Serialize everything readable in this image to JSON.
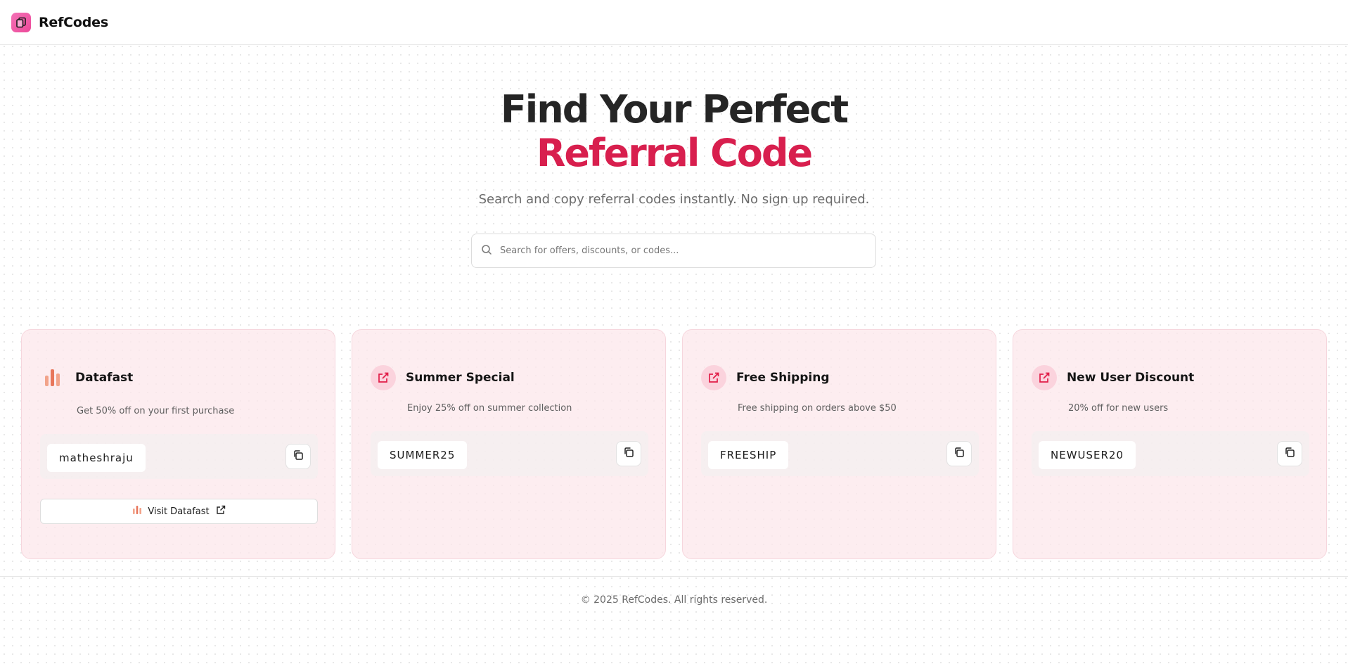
{
  "brand": {
    "name": "RefCodes",
    "logo_icon": "document-copy-icon",
    "accent": "#ec4899"
  },
  "hero": {
    "title_line1": "Find Your Perfect",
    "title_line2": "Referral Code",
    "title_accent_color": "#d81f4e",
    "subtitle": "Search and copy referral codes instantly. No sign up required."
  },
  "search": {
    "placeholder": "Search for offers, discounts, or codes...",
    "value": "",
    "icon": "search-icon"
  },
  "cards": [
    {
      "title": "Datafast",
      "icon": "datafast-bars-icon",
      "description": "Get 50% off on your first purchase",
      "code": "matheshraju",
      "visit_label": "Visit Datafast"
    },
    {
      "title": "Summer Special",
      "icon": "external-link-icon",
      "description": "Enjoy 25% off on summer collection",
      "code": "SUMMER25"
    },
    {
      "title": "Free Shipping",
      "icon": "external-link-icon",
      "description": "Free shipping on orders above $50",
      "code": "FREESHIP"
    },
    {
      "title": "New User Discount",
      "icon": "external-link-icon",
      "description": "20% off for new users",
      "code": "NEWUSER20"
    }
  ],
  "footer": {
    "text": "© 2025 RefCodes. All rights reserved."
  }
}
